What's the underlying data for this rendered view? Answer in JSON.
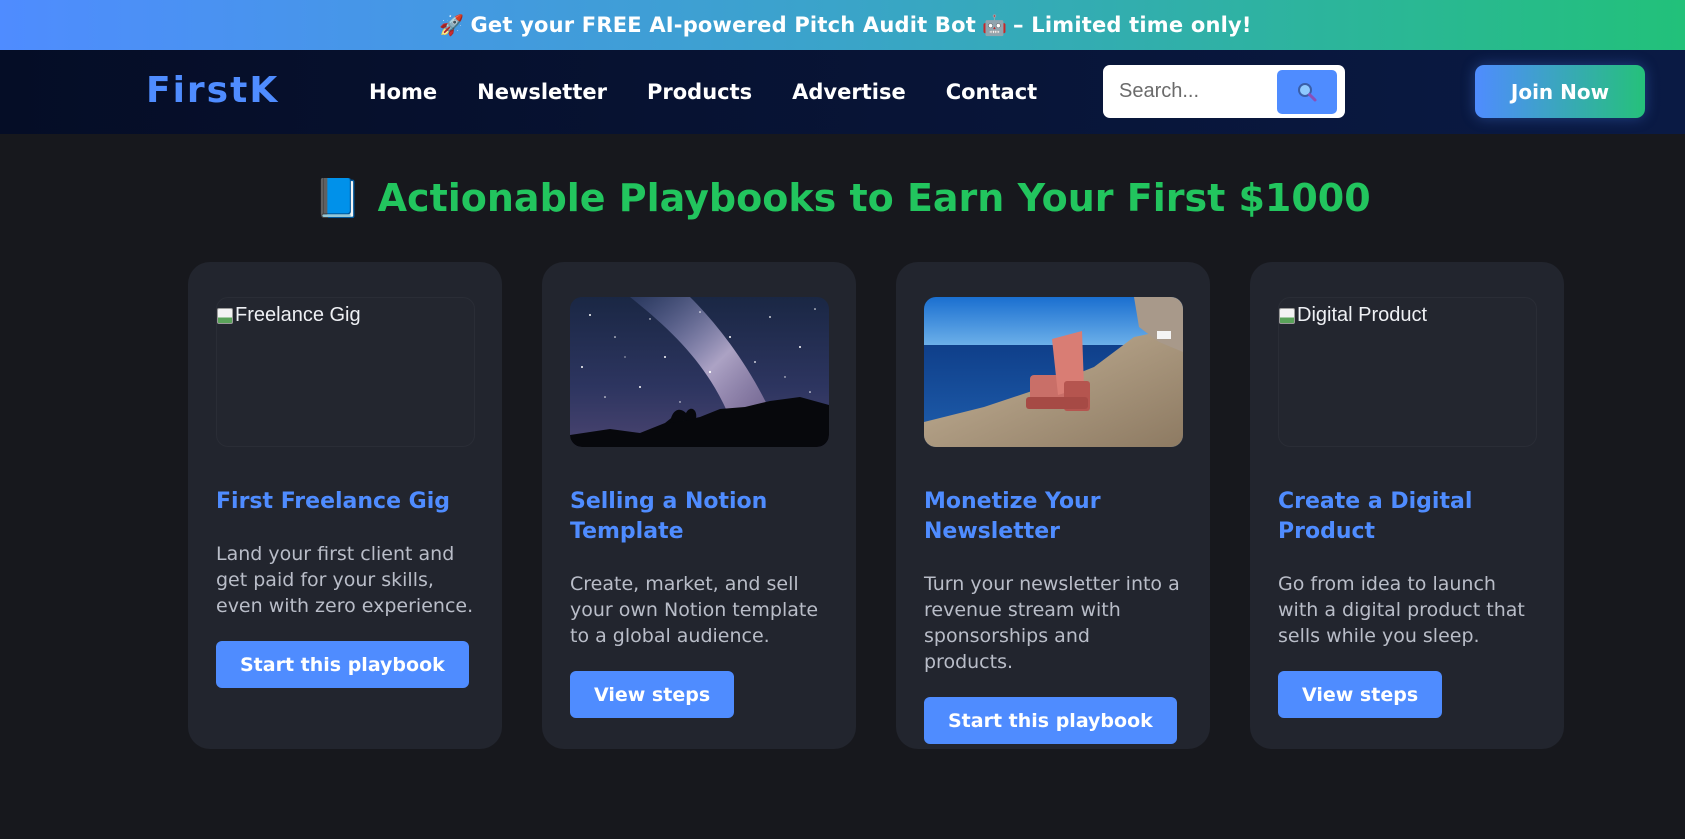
{
  "promo": {
    "icon_left": "rocket-icon",
    "text": "Get your FREE AI-powered Pitch Audit Bot",
    "icon_right": "robot-icon",
    "suffix": "– Limited time only!"
  },
  "nav": {
    "logo": "FirstK",
    "links": [
      "Home",
      "Newsletter",
      "Products",
      "Advertise",
      "Contact"
    ],
    "search_placeholder": "Search...",
    "join_label": "Join Now"
  },
  "colors": {
    "accent": "#4f8cff",
    "green": "#22c55e",
    "background": "#17181d",
    "card": "#22252e"
  },
  "main": {
    "title_icon": "blue-book-icon",
    "title": "Actionable Playbooks to Earn Your First $1000",
    "cards": [
      {
        "image_alt": "Freelance Gig",
        "image_state": "broken",
        "title": "First Freelance Gig",
        "description": "Land your first client and get paid for your skills, even with zero experience.",
        "button": "Start this playbook"
      },
      {
        "image_alt": "Milky way night sky",
        "image_state": "loaded",
        "title": "Selling a Notion Template",
        "description": "Create, market, and sell your own Notion template to a global audience.",
        "button": "View steps"
      },
      {
        "image_alt": "Armchair on a seaside cliff",
        "image_state": "loaded",
        "title": "Monetize Your Newsletter",
        "description": "Turn your newsletter into a revenue stream with sponsorships and products.",
        "button": "Start this playbook"
      },
      {
        "image_alt": "Digital Product",
        "image_state": "broken",
        "title": "Create a Digital Product",
        "description": "Go from idea to launch with a digital product that sells while you sleep.",
        "button": "View steps"
      }
    ]
  }
}
